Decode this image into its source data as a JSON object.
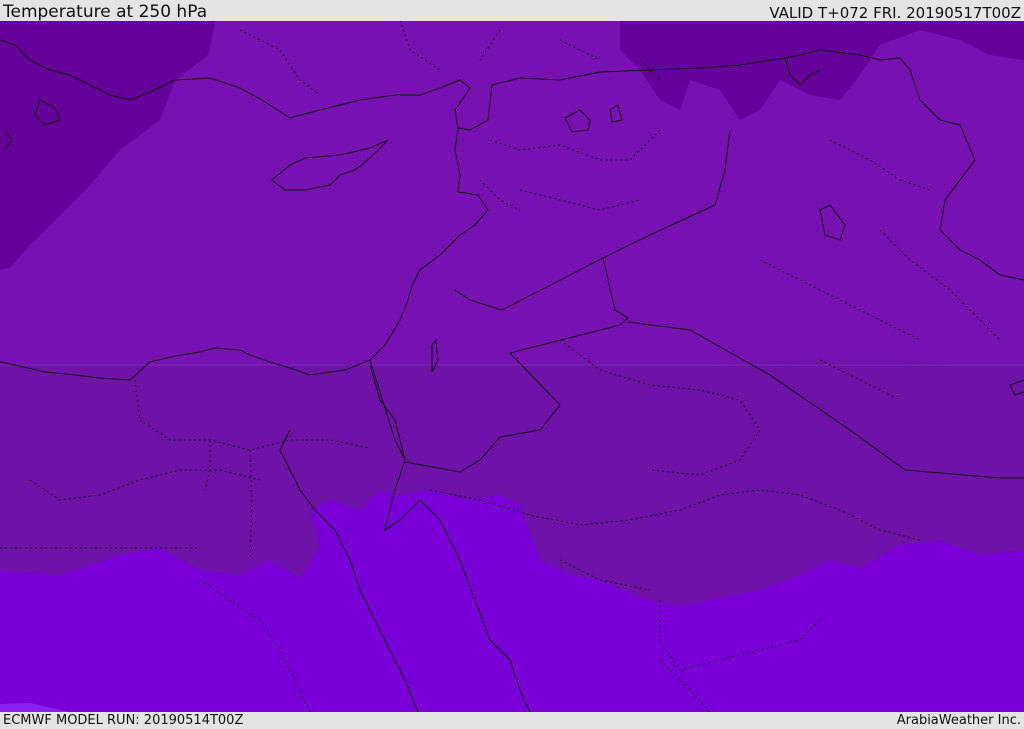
{
  "header": {
    "title": "Temperature at 250 hPa",
    "valid": "VALID T+072 FRI. 20190517T00Z"
  },
  "footer": {
    "model_run": "ECMWF MODEL RUN: 20190514T00Z",
    "credit": "ArabiaWeather Inc."
  },
  "map": {
    "region": "Eastern Mediterranean and Middle East",
    "field": "temperature-250hPa",
    "colors": {
      "coldest": "#65009a",
      "cold": "#7811b2",
      "base": "#6f12a8",
      "warm": "#7a00d8",
      "warmest": "#8a20ee"
    }
  }
}
